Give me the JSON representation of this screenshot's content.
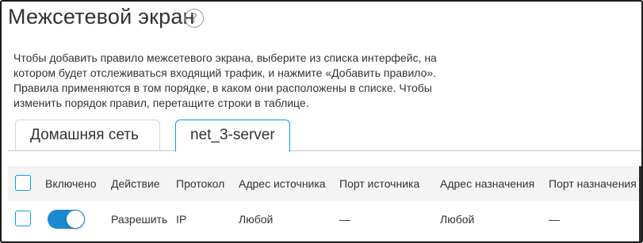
{
  "page": {
    "title": "Межсетевой экран",
    "help_icon_glyph": "?",
    "description_lines": [
      "Чтобы добавить правило межсетевого экрана, выберите из списка интерфейс, на",
      "котором будет отслеживаться входящий трафик, и нажмите «Добавить правило».",
      "Правила применяются в том порядке, в каком они расположены в списке. Чтобы",
      "изменить порядок правил, перетащите строки в таблице."
    ]
  },
  "tabs": [
    {
      "label": "Домашняя сеть",
      "active": false
    },
    {
      "label": "net_3-server",
      "active": true
    }
  ],
  "table": {
    "columns": [
      "Включено",
      "Действие",
      "Протокол",
      "Адрес источника",
      "Порт источника",
      "Адрес назначения",
      "Порт назначения"
    ],
    "rows": [
      {
        "checked": false,
        "enabled": true,
        "action": "Разрешить",
        "protocol": "IP",
        "source_address": "Любой",
        "source_port": "—",
        "destination_address": "Любой",
        "destination_port": "—"
      }
    ]
  },
  "colors": {
    "accent": "#00a3e0",
    "toggle_on": "#1a8ad1",
    "text": "#333333",
    "header_bg": "#f4f4f4"
  }
}
